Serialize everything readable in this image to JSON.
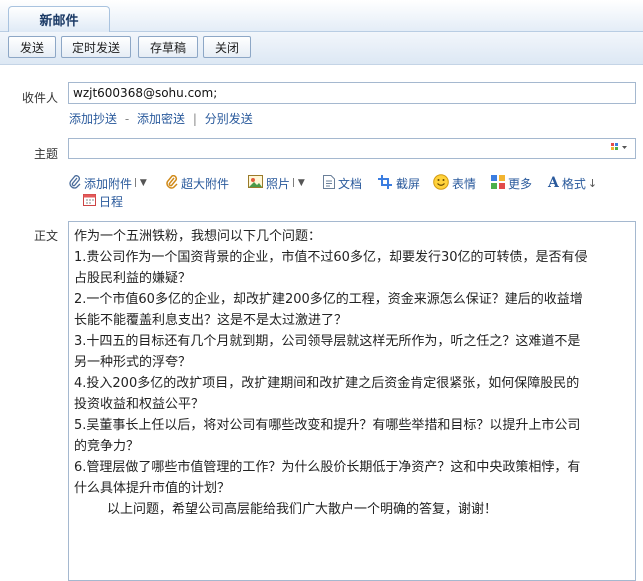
{
  "tab": {
    "label": "新邮件"
  },
  "toolbar": {
    "send": "发送",
    "scheduled_send": "定时发送",
    "save_draft": "存草稿",
    "close": "关闭"
  },
  "recipient": {
    "label": "收件人",
    "value": "wzjt600368@sohu.com;"
  },
  "recipient_links": {
    "add_cc": "添加抄送",
    "dash": "-",
    "add_bcc": "添加密送",
    "pipe": "|",
    "send_separately": "分别发送"
  },
  "subject": {
    "label": "主题",
    "value": ""
  },
  "attach_tools": {
    "add_attachment": "添加附件",
    "large_attachment": "超大附件",
    "photo": "照片",
    "document": "文档",
    "screenshot": "截屏",
    "emoji": "表情",
    "more": "更多",
    "format": "格式",
    "calendar": "日程"
  },
  "body": {
    "label": "正文",
    "lines": [
      "作为一个五洲铁粉，我想问以下几个问题：",
      "1.贵公司作为一个国资背景的企业，市值不过60多亿，却要发行30亿的可转债，是否有侵",
      "占股民利益的嫌疑？",
      "2.一个市值60多亿的企业，却改扩建200多亿的工程，资金来源怎么保证？建后的收益增",
      "长能不能覆盖利息支出？这是不是太过激进了？",
      "3.十四五的目标还有几个月就到期，公司领导层就这样无所作为，听之任之？这难道不是",
      "另一种形式的浮夸？",
      "4.投入200多亿的改扩项目，改扩建期间和改扩建之后资金肯定很紧张，如何保障股民的",
      "投资收益和权益公平？",
      "5.吴董事长上任以后，将对公司有哪些改变和提升？有哪些举措和目标？以提升上市公司",
      "的竞争力？",
      "6.管理层做了哪些市值管理的工作？为什么股价长期低于净资产？这和中央政策相悖，有",
      "什么具体提升市值的计划？",
      "以上问题，希望公司高层能给我们广大散户一个明确的答复，谢谢！"
    ]
  },
  "colors": {
    "accent": "#2a5a9c",
    "border": "#a5b8cf",
    "toolbar_bg": "#dde8f4"
  }
}
